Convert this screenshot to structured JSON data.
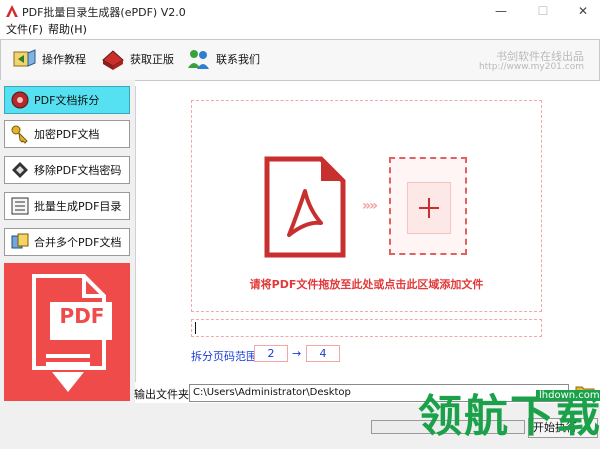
{
  "window": {
    "title": "PDF批量目录生成器(ePDF) V2.0",
    "minimize": "—",
    "maximize": "☐",
    "close": "✕"
  },
  "menu": [
    {
      "label": "文件(F)"
    },
    {
      "label": "帮助(H)"
    }
  ],
  "toolbar": {
    "items": [
      {
        "label": "操作教程",
        "icon": "tutorial-icon"
      },
      {
        "label": "获取正版",
        "icon": "cart-icon"
      },
      {
        "label": "联系我们",
        "icon": "contact-icon"
      }
    ],
    "watermark": "书剑软件在线出品",
    "watermark_url": "http://www.my201.com"
  },
  "sidebar": {
    "items": [
      {
        "label": "PDF文档拆分",
        "active": true,
        "icon": "split-icon"
      },
      {
        "label": "加密PDF文档",
        "active": false,
        "icon": "key-icon"
      },
      {
        "label": "移除PDF文档密码",
        "active": false,
        "icon": "unlock-icon"
      },
      {
        "label": "批量生成PDF目录",
        "active": false,
        "icon": "toc-icon"
      },
      {
        "label": "合并多个PDF文档",
        "active": false,
        "icon": "merge-icon"
      }
    ],
    "banner_text": "PDF",
    "banner_color": "#ef4b4b"
  },
  "main": {
    "drop_hint": "请将PDF文件拖放至此处或点击此区域添加文件",
    "chevrons": "»»",
    "range_label": "拆分页码范围",
    "range_from": "2",
    "range_arrow": "→",
    "range_to": "4"
  },
  "bottom": {
    "output_label": "输出文件夹",
    "output_path": "C:\\Users\\Administrator\\Desktop",
    "run_label": "开始执行",
    "site_watermark": "领航下载",
    "site_url": "lhdown.com"
  },
  "colors": {
    "accent_active": "#56e1f3",
    "pdf_red": "#e23a3a",
    "link_blue": "#1a3bd6",
    "site_green": "#1aa14a"
  }
}
